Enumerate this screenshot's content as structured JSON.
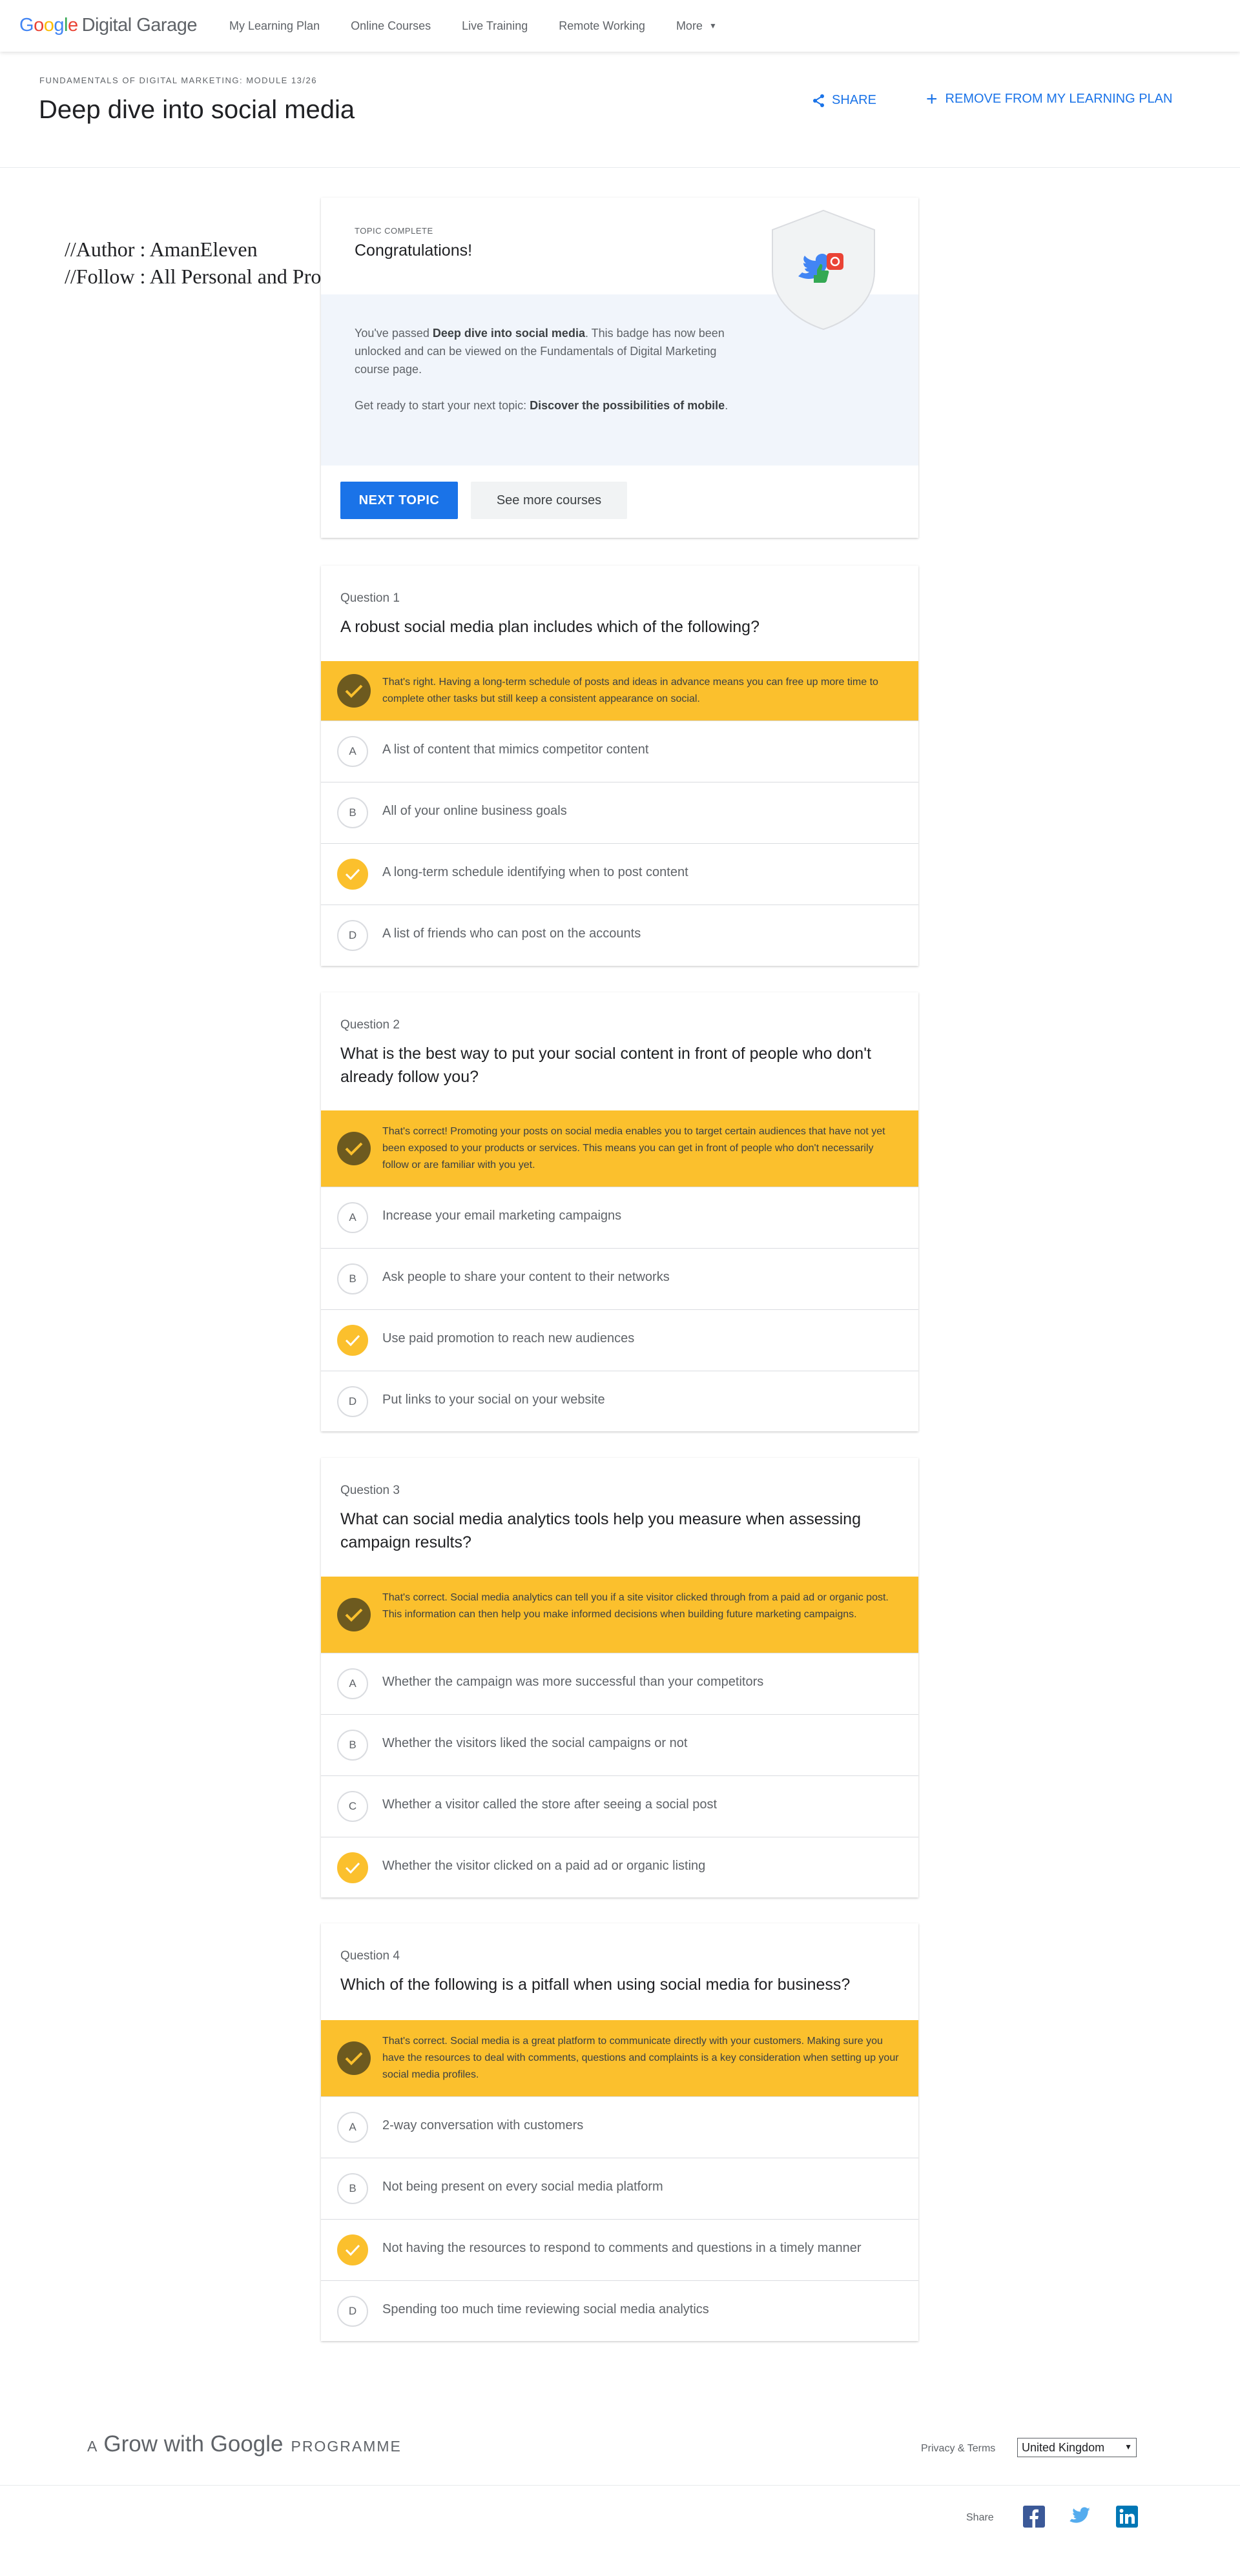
{
  "nav": {
    "logo_google": "Google",
    "logo_product": "Digital Garage",
    "links": [
      "My Learning Plan",
      "Online Courses",
      "Live Training",
      "Remote Working",
      "More"
    ]
  },
  "header": {
    "eyebrow": "FUNDAMENTALS OF DIGITAL MARKETING: MODULE 13/26",
    "title": "Deep dive into social media",
    "share_label": "SHARE",
    "remove_label": "REMOVE FROM MY LEARNING PLAN"
  },
  "overlay": {
    "author": "//Author : AmanEleven",
    "follow": "//Follow : All Personal and Professional Links Here -->  https://linktr.ee/amaneleven"
  },
  "completion": {
    "label": "TOPIC COMPLETE",
    "congrats": "Congratulations!",
    "p1_pre": "You've passed ",
    "p1_bold": "Deep dive into social media",
    "p1_post": ". This badge has now been unlocked and can be viewed on the Fundamentals of Digital Marketing course page.",
    "p2_pre": "Get ready to start your next topic: ",
    "p2_bold": "Discover the possibilities of mobile",
    "p2_post": ".",
    "next_button": "NEXT TOPIC",
    "more_button": "See more courses"
  },
  "questions": [
    {
      "number": "Question 1",
      "text": "A robust social media plan includes which of the following?",
      "feedback": "That's right. Having a long-term schedule of posts and ideas in advance means you can free up more time to complete other tasks but still keep a consistent appearance on social.",
      "options": [
        {
          "letter": "A",
          "text": "A list of content that mimics competitor content"
        },
        {
          "letter": "B",
          "text": "All of your online business goals"
        },
        {
          "letter": "C",
          "text": "A long-term schedule identifying when to post content"
        },
        {
          "letter": "D",
          "text": "A list of friends who can post on the accounts"
        }
      ]
    },
    {
      "number": "Question 2",
      "text": "What is the best way to put your social content in front of people who don't already follow you?",
      "feedback": "That's correct! Promoting your posts on social media enables you to target certain audiences that have not yet been exposed to your products or services. This means you can get in front of people who don't necessarily follow or are familiar with you yet.",
      "options": [
        {
          "letter": "A",
          "text": "Increase your email marketing campaigns"
        },
        {
          "letter": "B",
          "text": "Ask people to share your content to their networks"
        },
        {
          "letter": "C",
          "text": "Use paid promotion to reach new audiences"
        },
        {
          "letter": "D",
          "text": "Put links to your social on your website"
        }
      ]
    },
    {
      "number": "Question 3",
      "text": "What can social media analytics tools help you measure when assessing campaign results?",
      "feedback": "That's correct. Social media analytics can tell you if a site visitor clicked through from a paid ad or organic post. This information can then help you make informed decisions when building future marketing campaigns.",
      "options": [
        {
          "letter": "A",
          "text": "Whether the campaign was more successful than your competitors"
        },
        {
          "letter": "B",
          "text": "Whether the visitors liked the social campaigns or not"
        },
        {
          "letter": "C",
          "text": "Whether a visitor called the store after seeing a social post"
        },
        {
          "letter": "D",
          "text": "Whether the visitor clicked on a paid ad or organic listing"
        }
      ]
    },
    {
      "number": "Question 4",
      "text": "Which of the following is a pitfall when using social media for business?",
      "feedback": "That's correct. Social media is a great platform to communicate directly with your customers. Making sure you have the resources to deal with comments, questions and complaints is a key consideration when setting up your social media profiles.",
      "options": [
        {
          "letter": "A",
          "text": "2-way conversation with customers"
        },
        {
          "letter": "B",
          "text": "Not being present on every social media platform"
        },
        {
          "letter": "C",
          "text": "Not having the resources to respond to comments and questions in a timely manner"
        },
        {
          "letter": "D",
          "text": "Spending too much time reviewing social media analytics"
        }
      ]
    }
  ],
  "footer": {
    "logo_a": "A",
    "logo_main": "Grow with Google",
    "logo_programme": "PROGRAMME",
    "privacy": "Privacy & Terms",
    "region": "United Kingdom",
    "share_label": "Share"
  },
  "colors": {
    "accent": "#1a73e8",
    "feedback": "#fbc02d",
    "check_dark": "#6d5a1f"
  }
}
